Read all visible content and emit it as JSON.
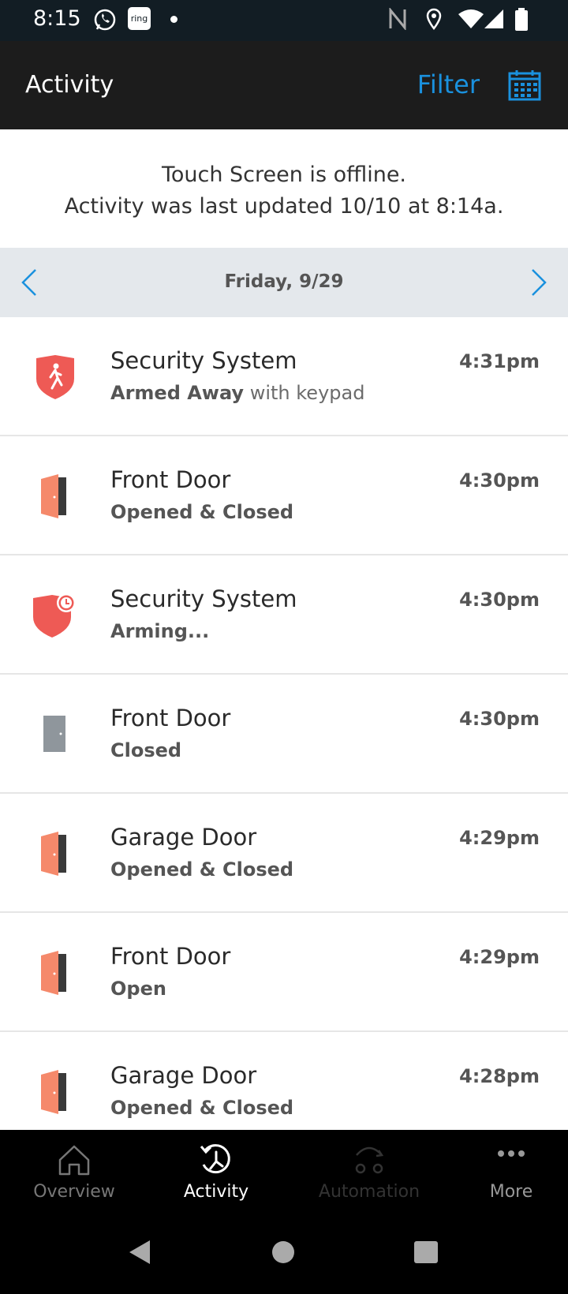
{
  "status_bar": {
    "time": "8:15",
    "ring_label": "ring"
  },
  "header": {
    "title": "Activity",
    "filter_label": "Filter"
  },
  "notice": {
    "line1": "Touch Screen is offline.",
    "line2": "Activity was last updated 10/10 at 8:14a."
  },
  "date_bar": {
    "date": "Friday, 9/29"
  },
  "events": [
    {
      "name": "Security System",
      "desc_bold": "Armed Away",
      "desc": " with keypad",
      "time": "4:31pm",
      "icon": "security-armed-away-icon"
    },
    {
      "name": "Front Door",
      "desc_bold": "",
      "desc": "Opened & Closed",
      "time": "4:30pm",
      "icon": "door-open-icon"
    },
    {
      "name": "Security System",
      "desc_bold": "",
      "desc": "Arming...",
      "time": "4:30pm",
      "icon": "security-arming-icon"
    },
    {
      "name": "Front Door",
      "desc_bold": "",
      "desc": "Closed",
      "time": "4:30pm",
      "icon": "door-closed-icon"
    },
    {
      "name": "Garage Door",
      "desc_bold": "",
      "desc": "Opened & Closed",
      "time": "4:29pm",
      "icon": "door-open-icon"
    },
    {
      "name": "Front Door",
      "desc_bold": "",
      "desc": "Open",
      "time": "4:29pm",
      "icon": "door-open-icon"
    },
    {
      "name": "Garage Door",
      "desc_bold": "",
      "desc": "Opened & Closed",
      "time": "4:28pm",
      "icon": "door-open-icon"
    }
  ],
  "bottom_nav": [
    {
      "label": "Overview",
      "icon": "home-icon",
      "state": "normal"
    },
    {
      "label": "Activity",
      "icon": "history-icon",
      "state": "active"
    },
    {
      "label": "Automation",
      "icon": "automation-icon",
      "state": "disabled"
    },
    {
      "label": "More",
      "icon": "more-icon",
      "state": "normal"
    }
  ],
  "colors": {
    "accent": "#1a91de",
    "alert_red": "#ee5a55",
    "door_orange": "#f5896b",
    "header_bg": "#1c1c1c",
    "date_bar_bg": "#e4e8ec"
  }
}
